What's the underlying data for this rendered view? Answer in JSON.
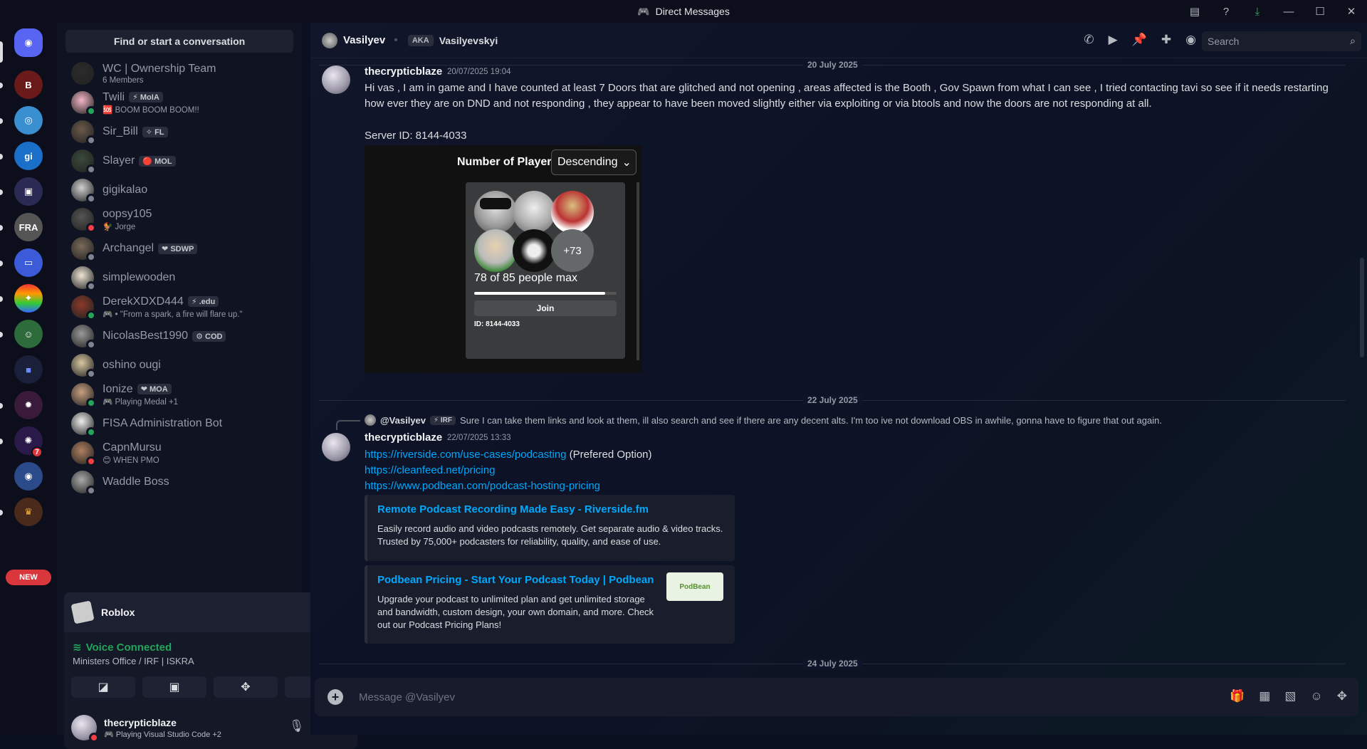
{
  "window": {
    "title": "Direct Messages"
  },
  "rail": {
    "new_label": "NEW",
    "mention_count": "7"
  },
  "sidebar": {
    "find_label": "Find or start a conversation",
    "dms": [
      {
        "name": "WC | Ownership Team",
        "sub": "6 Members",
        "tag": "",
        "status": ""
      },
      {
        "name": "Twili",
        "sub": "🆘 BOOM BOOM BOOM!!",
        "tag": "⚡ MoIA",
        "status": "on"
      },
      {
        "name": "Sir_Bill",
        "sub": "",
        "tag": "✧ FL",
        "status": "off"
      },
      {
        "name": "Slayer",
        "sub": "",
        "tag": "🔴 MOL",
        "status": "off"
      },
      {
        "name": "gigikalao",
        "sub": "",
        "tag": "",
        "status": "off"
      },
      {
        "name": "oopsy105",
        "sub": "🐓 Jorge",
        "tag": "",
        "status": "dnd"
      },
      {
        "name": "Archangel",
        "sub": "",
        "tag": "❤ SDWP",
        "status": "off"
      },
      {
        "name": "simplewooden",
        "sub": "",
        "tag": "",
        "status": "off"
      },
      {
        "name": "DerekXDXD444",
        "sub": "🎮 • \"From a spark, a fire will flare up.\"",
        "tag": "⚡ .edu",
        "status": "on"
      },
      {
        "name": "NicolasBest1990",
        "sub": "",
        "tag": "⚙ COD",
        "status": "off"
      },
      {
        "name": "oshino ougi",
        "sub": "",
        "tag": "",
        "status": "off"
      },
      {
        "name": "Ionize",
        "sub": "🎮 Playing Medal +1",
        "tag": "❤ MOA",
        "status": "on"
      },
      {
        "name": "FISA Administration Bot",
        "sub": "",
        "tag": "",
        "status": "on"
      },
      {
        "name": "CapnMursu",
        "sub": "😊 WHEN PMO",
        "tag": "",
        "status": "dnd"
      },
      {
        "name": "Waddle Boss",
        "sub": "",
        "tag": "",
        "status": "off"
      }
    ]
  },
  "panel": {
    "activity": "Roblox",
    "voice_title": "Voice Connected",
    "voice_channel": "Ministers Office / IRF | ISKRA",
    "user_name": "thecrypticblaze",
    "user_status": "Playing Visual Studio Code +2"
  },
  "header": {
    "name": "Vasilyev",
    "aka_label": "AKA",
    "aka_name": "Vasilyevskyi",
    "search_placeholder": "Search"
  },
  "dates": {
    "d1": "20 July 2025",
    "d2": "22 July 2025",
    "d3": "24 July 2025"
  },
  "msg1": {
    "author": "thecrypticblaze",
    "time": "20/07/2025 19:04",
    "text": "Hi vas , I am in game and I have counted at least 7 Doors that are glitched and not opening , areas affected is the Booth , Gov Spawn from what I can see , I tried contacting tavi so see if it needs restarting how ever they are on DND and not responding , they appear to have been moved slightly either via exploiting or via btools and now the doors are not responding at all.",
    "server_id": "Server ID: 8144-4033"
  },
  "screenshot": {
    "title": "Number of Players",
    "sort": "Descending",
    "more": "+73",
    "count": "78 of 85 people max",
    "fill_fraction": 0.92,
    "join": "Join",
    "id": "ID: 8144-4033"
  },
  "msg2": {
    "reply_name": "@Vasilyev",
    "reply_tag": "⚡ IRF",
    "reply_text": "Sure I can take them links and look at them, ill also search and see if there are any decent alts. I'm too ive not download OBS in awhile, gonna have to figure that out again.",
    "author": "thecrypticblaze",
    "time": "22/07/2025 13:33",
    "link1": "https://riverside.com/use-cases/podcasting",
    "link1_suffix": "(Prefered Option)",
    "link2": "https://cleanfeed.net/pricing",
    "link3": "https://www.podbean.com/podcast-hosting-pricing",
    "embed1_title": "Remote Podcast Recording Made Easy - Riverside.fm",
    "embed1_desc": "Easily record audio and video podcasts remotely. Get separate audio & video tracks. Trusted by 75,000+ podcasters for reliability, quality, and ease of use.",
    "embed2_title": "Podbean Pricing - Start Your Podcast Today | Podbean",
    "embed2_desc": "Upgrade your podcast to unlimited plan and get unlimited storage and bandwidth, custom design, your own domain, and more. Check out our Podcast Pricing Plans!",
    "embed2_thumb": "PodBean"
  },
  "composer": {
    "placeholder": "Message @Vasilyev"
  }
}
